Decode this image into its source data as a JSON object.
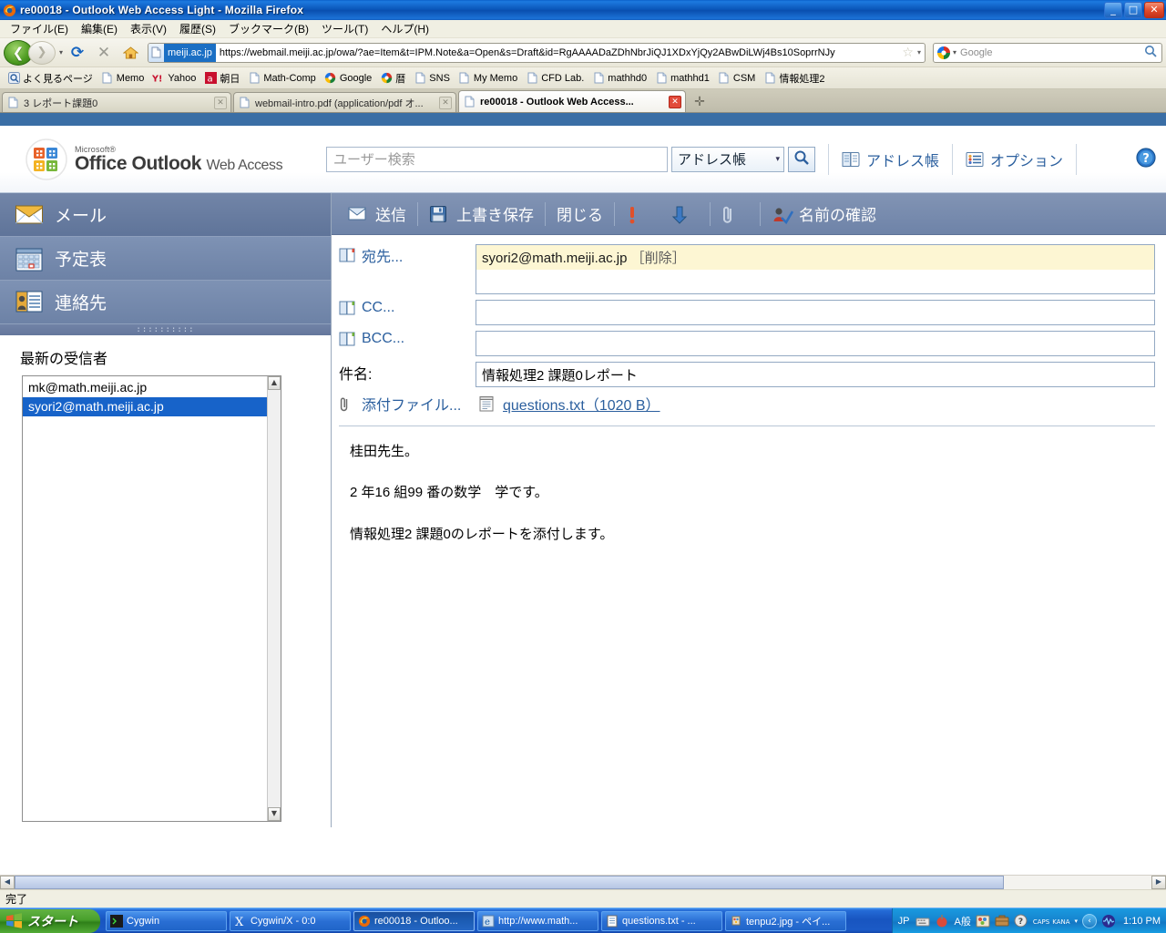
{
  "window": {
    "title": "re00018 - Outlook Web Access Light - Mozilla Firefox",
    "minimize_label": "_",
    "maximize_label": "□",
    "close_label": "✕"
  },
  "menubar": {
    "items": [
      {
        "label": "ファイル(E)"
      },
      {
        "label": "編集(E)"
      },
      {
        "label": "表示(V)"
      },
      {
        "label": "履歴(S)"
      },
      {
        "label": "ブックマーク(B)"
      },
      {
        "label": "ツール(T)"
      },
      {
        "label": "ヘルプ(H)"
      }
    ]
  },
  "navbar": {
    "back_icon": "back-arrow-icon",
    "forward_icon": "forward-arrow-icon",
    "reload_label": "⟳",
    "stop_label": "✕",
    "home_icon": "home-icon",
    "url_domain": "meiji.ac.jp",
    "url": "https://webmail.meiji.ac.jp/owa/?ae=Item&t=IPM.Note&a=Open&s=Draft&id=RgAAAADaZDhNbrJiQJ1XDxYjQy2ABwDiLWj4Bs10SoprrNJy",
    "star_label": "☆",
    "dropdown_label": "▾",
    "search_placeholder": "Google",
    "search_value": ""
  },
  "bookmarks": {
    "items": [
      {
        "label": "よく見るページ",
        "icon": "history-icon"
      },
      {
        "label": "Memo",
        "icon": "page-icon"
      },
      {
        "label": "Yahoo",
        "icon": "yahoo-icon"
      },
      {
        "label": "朝日",
        "icon": "asahi-icon"
      },
      {
        "label": "Math-Comp",
        "icon": "page-icon"
      },
      {
        "label": "Google",
        "icon": "google-icon"
      },
      {
        "label": "暦",
        "icon": "google-icon"
      },
      {
        "label": "SNS",
        "icon": "page-icon"
      },
      {
        "label": "My Memo",
        "icon": "page-icon"
      },
      {
        "label": "CFD Lab.",
        "icon": "page-icon"
      },
      {
        "label": "mathhd0",
        "icon": "page-icon"
      },
      {
        "label": "mathhd1",
        "icon": "page-icon"
      },
      {
        "label": "CSM",
        "icon": "page-icon"
      },
      {
        "label": "情報処理2",
        "icon": "page-icon"
      }
    ]
  },
  "tabs": {
    "items": [
      {
        "label": "3 レポート課題0",
        "active": false
      },
      {
        "label": "webmail-intro.pdf (application/pdf オ...",
        "active": false
      },
      {
        "label": "re00018 - Outlook Web Access...",
        "active": true
      }
    ],
    "close_label": "✕",
    "newtab_label": "✛"
  },
  "owa": {
    "logo": {
      "microsoft": "Microsoft®",
      "product": "Office Outlook",
      "suffix": "Web Access"
    },
    "search": {
      "placeholder": "ユーザー検索",
      "value": "",
      "scope": "アドレス帳",
      "caret": "▾",
      "go_icon": "search-magnifier-icon"
    },
    "links": [
      {
        "label": "アドレス帳",
        "icon": "address-book-icon"
      },
      {
        "label": "オプション",
        "icon": "options-list-icon"
      }
    ],
    "help_icon": "help-question-icon",
    "sidebar": {
      "items": [
        {
          "label": "メール",
          "icon": "envelope-icon",
          "selected": true
        },
        {
          "label": "予定表",
          "icon": "calendar-icon",
          "selected": false
        },
        {
          "label": "連絡先",
          "icon": "contacts-icon",
          "selected": false
        }
      ],
      "grip": "::::::::::",
      "recent_title": "最新の受信者",
      "recent_items": [
        {
          "label": "mk@math.meiji.ac.jp",
          "selected": false
        },
        {
          "label": "syori2@math.meiji.ac.jp",
          "selected": true
        }
      ],
      "scroll_up": "▲",
      "scroll_down": "▼"
    },
    "toolbar": {
      "send_label": "送信",
      "save_label": "上書き保存",
      "close_label": "閉じる",
      "high_priority_icon": "high-priority-icon",
      "low_priority_icon": "low-priority-icon",
      "attach_icon": "paperclip-icon",
      "check_names_label": "名前の確認"
    },
    "form": {
      "to_label": "宛先...",
      "to_value": "syori2@math.meiji.ac.jp",
      "to_remove": "［削除］",
      "cc_label": "CC...",
      "cc_value": "",
      "bcc_label": "BCC...",
      "bcc_value": "",
      "subject_label": "件名:",
      "subject_value": "情報処理2  課題0レポート",
      "attach_label": "添付ファイル...",
      "attachment_name": "questions.txt（1020 B）"
    },
    "body": {
      "line1": "桂田先生。",
      "line2": "2 年16 組99 番の数学　学です。",
      "line3": "情報処理2 課題0のレポートを添付します。"
    }
  },
  "scrollbar": {
    "left_label": "◀",
    "right_label": "▶"
  },
  "statusbar": {
    "text": "完了"
  },
  "taskbar": {
    "start_label": "スタート",
    "tasks": [
      {
        "label": "Cygwin",
        "icon": "cygwin-icon",
        "active": false
      },
      {
        "label": "Cygwin/X - 0:0",
        "icon": "xorg-icon",
        "active": false
      },
      {
        "label": "re00018 - Outloo...",
        "icon": "firefox-icon",
        "active": true
      },
      {
        "label": "http://www.math...",
        "icon": "ie-icon",
        "active": false
      },
      {
        "label": "questions.txt - ...",
        "icon": "notepad-icon",
        "active": false
      },
      {
        "label": "tenpu2.jpg - ペイ...",
        "icon": "paint-icon",
        "active": false
      }
    ],
    "tray": {
      "ime_lang": "JP",
      "ime_mode": "A般",
      "caps_label": "CAPS",
      "kana_label": "KANA",
      "kana_caret": "▾",
      "icons": [
        "keyboard-icon",
        "ime-pad-icon",
        "ime-dict-icon",
        "ime-tools-icon",
        "help-icon"
      ],
      "arrow_label": "‹",
      "clock": "1:10 PM"
    }
  },
  "colors": {
    "titlebar_blue": "#0a55b8",
    "owa_nav_blue": "#6d82a6",
    "accent_link": "#2b5f9e",
    "highlight_yellow": "#fdf6d3",
    "selection_blue": "#1763c9"
  }
}
